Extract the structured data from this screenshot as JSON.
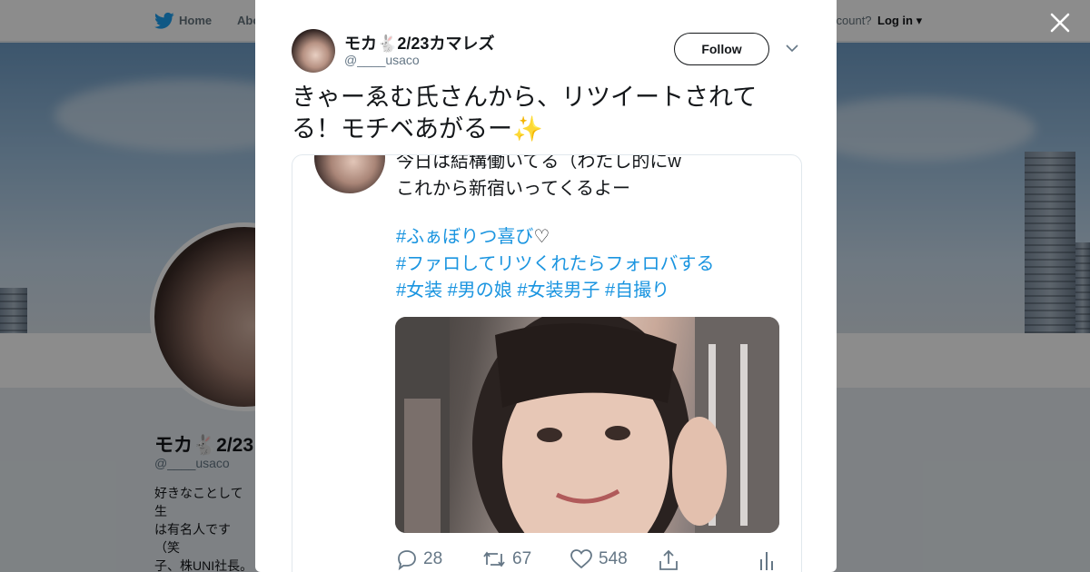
{
  "nav": {
    "home_label": "Home",
    "about_label": "Abo",
    "account_text": "ccount?",
    "login_label": "Log in"
  },
  "profile": {
    "name": "モカ🐇2/23",
    "handle": "@____usaco",
    "bio": "好きなことして生\nは有名人です（笑\n子、株UNI社長。\n女の子クラブ・無\nす✨モカ🐇ファ"
  },
  "tweet": {
    "author_name": "モカ🐇2/23カマレズ",
    "author_handle": "@____usaco",
    "follow_label": "Follow",
    "text": "きゃーゑむ氏さんから、リツイートされてる！モチベあがるー",
    "emoji": "✨"
  },
  "quoted": {
    "line1": "今日は結構働いてる（わたし的にw",
    "line2": "これから新宿いってくるよー",
    "tag_lines": [
      "#ふぁぼりつ喜び",
      "#ファロしてリツくれたらフォロバする",
      "#女装 #男の娘 #女装男子 #自撮り"
    ],
    "heart": "♡",
    "reply_count": "28",
    "retweet_count": "67",
    "like_count": "548"
  },
  "colors": {
    "accent": "#1b95e0",
    "text": "#14171a",
    "muted": "#657786",
    "twitter_blue": "#1da1f2"
  }
}
